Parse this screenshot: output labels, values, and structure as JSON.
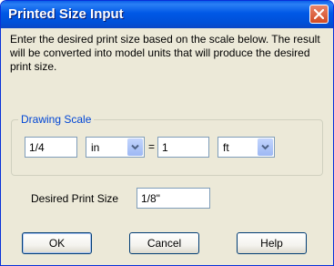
{
  "window": {
    "title": "Printed Size Input",
    "close_icon": "close-icon"
  },
  "description": "Enter the desired print size based on the scale below. The result will be converted into model units that will produce the desired print size.",
  "drawing_scale": {
    "legend": "Drawing Scale",
    "left_value": "1/4",
    "left_unit": "in",
    "equals": "=",
    "right_value": "1",
    "right_unit": "ft"
  },
  "print_size": {
    "label": "Desired Print Size",
    "value": "1/8\""
  },
  "buttons": {
    "ok": "OK",
    "cancel": "Cancel",
    "help": "Help"
  },
  "colors": {
    "title_bar": "#0058e6",
    "close_button": "#d24a23",
    "group_legend": "#0046d5",
    "dialog_bg": "#ece9d8"
  }
}
